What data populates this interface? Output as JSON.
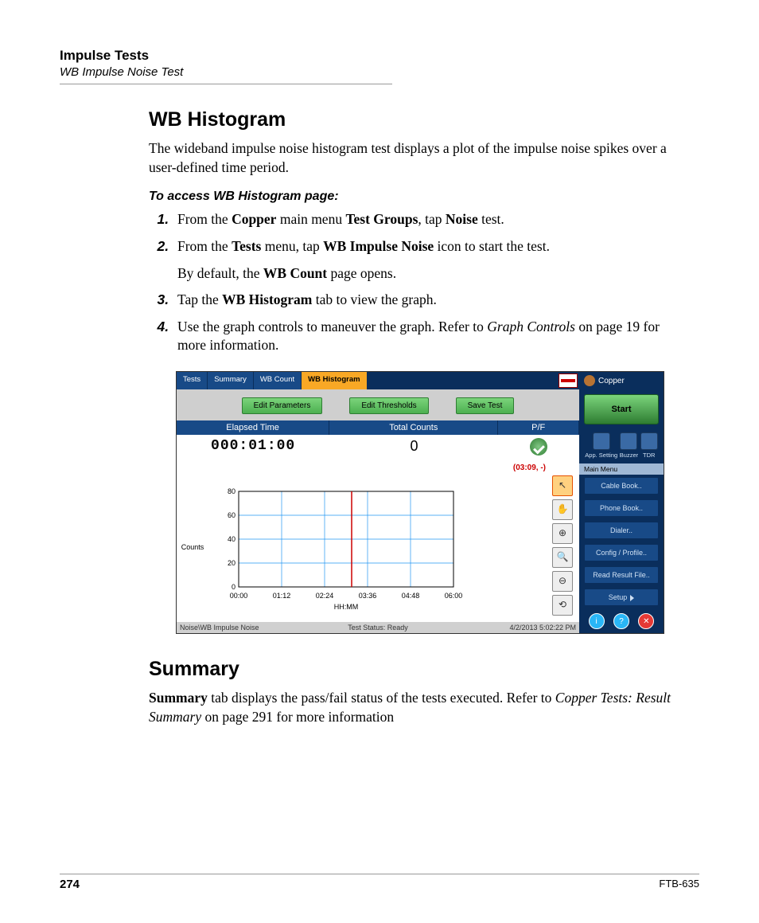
{
  "header": {
    "title": "Impulse Tests",
    "subtitle": "WB Impulse Noise Test"
  },
  "section1": {
    "heading": "WB Histogram",
    "intro": "The wideband impulse noise histogram test displays a plot of the impulse noise spikes over a user-defined time period.",
    "access_title": "To access WB Histogram page:",
    "steps": {
      "s1a": "From the ",
      "s1b": "Copper",
      "s1c": " main menu ",
      "s1d": "Test Groups",
      "s1e": ", tap ",
      "s1f": "Noise",
      "s1g": " test.",
      "s2a": "From the ",
      "s2b": "Tests",
      "s2c": " menu, tap ",
      "s2d": "WB Impulse Noise",
      "s2e": " icon to start the test.",
      "s2sub_a": "By default, the ",
      "s2sub_b": "WB Count",
      "s2sub_c": " page opens.",
      "s3a": "Tap the ",
      "s3b": "WB Histogram",
      "s3c": " tab to view the graph.",
      "s4a": "Use the graph controls to maneuver the graph. Refer to ",
      "s4b": "Graph Controls",
      "s4c": " on page 19 for more information."
    }
  },
  "screenshot": {
    "tabs": [
      "Tests",
      "Summary",
      "WB Count",
      "WB Histogram"
    ],
    "active_tab_index": 3,
    "buttons": {
      "edit_params": "Edit Parameters",
      "edit_thresh": "Edit Thresholds",
      "save_test": "Save Test"
    },
    "header_cells": {
      "elapsed": "Elapsed Time",
      "total": "Total Counts",
      "pf": "P/F"
    },
    "values": {
      "elapsed": "000:01:00",
      "total": "0"
    },
    "note": "(03:09, -)",
    "ylabel": "Counts",
    "xlabel": "HH:MM",
    "status": {
      "left": "Noise\\WB Impulse Noise",
      "center": "Test Status: Ready",
      "right": "4/2/2013 5:02:22 PM"
    },
    "tool_icons": [
      "arrow-cursor-icon",
      "hand-pan-icon",
      "zoom-in-icon",
      "zoom-area-icon",
      "zoom-out-icon",
      "zoom-reset-icon"
    ],
    "side": {
      "copper": "Copper",
      "start": "Start",
      "tri": [
        "App. Setting",
        "Buzzer",
        "TDR"
      ],
      "main_menu": "Main Menu",
      "items": [
        "Cable Book..",
        "Phone Book..",
        "Dialer..",
        "Config / Profile..",
        "Read Result File..",
        "Setup"
      ]
    }
  },
  "section2": {
    "heading": "Summary",
    "p_a": "Summary",
    "p_b": " tab displays the pass/fail status of the tests executed. Refer to ",
    "p_c": "Copper Tests: Result Summary",
    "p_d": " on page 291 for more information"
  },
  "footer": {
    "page": "274",
    "model": "FTB-635"
  },
  "chart_data": {
    "type": "line",
    "title": "",
    "xlabel": "HH:MM",
    "ylabel": "Counts",
    "categories": [
      "00:00",
      "01:12",
      "02:24",
      "03:36",
      "04:48",
      "06:00"
    ],
    "values": [
      0,
      0,
      0,
      0,
      0,
      0
    ],
    "y_ticks": [
      0.0,
      20.0,
      40.0,
      60.0,
      80.0
    ],
    "ylim": [
      0,
      80
    ],
    "marker_x": "03:09",
    "annotation": "(03:09, -)"
  }
}
